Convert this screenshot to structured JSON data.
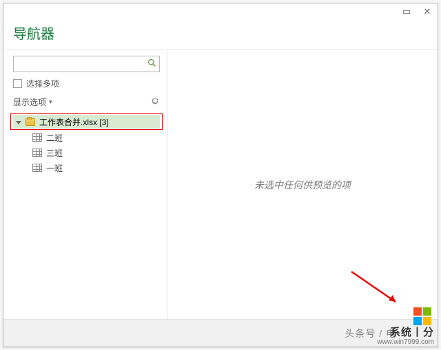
{
  "window": {
    "title": "导航器"
  },
  "left": {
    "search_placeholder": "",
    "multi_select_label": "选择多项",
    "display_options_label": "显示选项",
    "file_label": "工作表合并.xlsx [3]",
    "sheets": [
      "二班",
      "三班",
      "一班"
    ]
  },
  "preview": {
    "empty_text": "未选中任何供预览的项"
  },
  "footer": {
    "text": "头条号 / 电"
  },
  "watermark": {
    "line1": "系统丨分",
    "line2": "www.win7999.com"
  }
}
